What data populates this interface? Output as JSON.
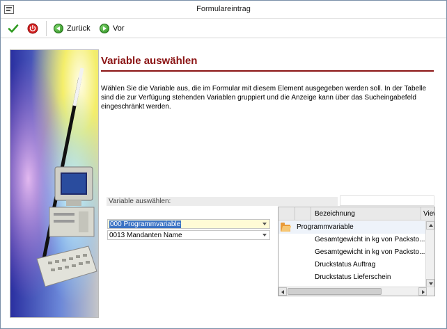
{
  "window": {
    "title": "Formulareintrag"
  },
  "toolbar": {
    "back_label": "Zurück",
    "forward_label": "Vor",
    "icons": [
      "checkmark-icon",
      "power-icon",
      "back-arrow-icon",
      "forward-arrow-icon"
    ]
  },
  "main": {
    "heading": "Variable auswählen",
    "description": "Wählen Sie die Variable aus, die im Formular mit diesem Element ausgegeben werden soll. In der Tabelle sind die zur Verfügung stehenden Variablen gruppiert und die Anzeige kann über das Sucheingabefeld eingeschränkt werden.",
    "variable_label": "Variable auswählen:",
    "search_value": "",
    "combo_1": "000 Programmvariable",
    "combo_2": "0013 Mandanten Name"
  },
  "grid": {
    "columns": [
      "",
      "",
      "Bezeichnung",
      "View"
    ],
    "group": "Programmvariable",
    "rows": [
      "Gesamtgewicht in kg von Packsto...",
      "Gesamtgewicht in kg von Packsto...",
      "Druckstatus Auftrag",
      "Druckstatus Lieferschein"
    ]
  },
  "colors": {
    "heading": "#8b1414",
    "accent_green": "#2b8a1e",
    "power_red": "#c81e1e",
    "selection": "#3b73c4"
  }
}
